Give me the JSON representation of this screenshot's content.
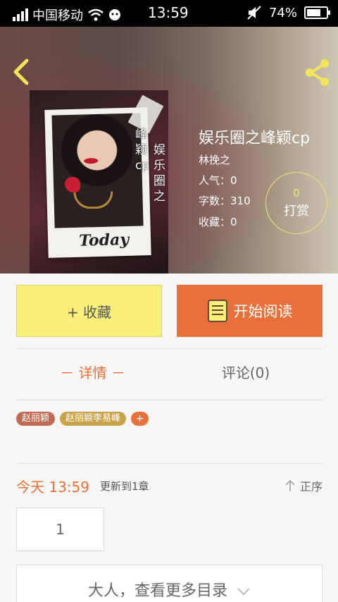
{
  "status_bar": {
    "carrier": "中国移动",
    "time": "13:59",
    "battery": "74%",
    "battery_level": 0.74
  },
  "book": {
    "title": "娱乐圈之峰颖cp",
    "author": "林挽之",
    "popularity": "人气：0",
    "word_count": "字数：310",
    "favorites": "收藏：0",
    "cover_caption": "Today",
    "cover_text_a": "峰颖cp",
    "cover_text_b": "娱乐圈之"
  },
  "tip": {
    "count": "0",
    "label": "打赏"
  },
  "actions": {
    "collect_label": "+ 收藏",
    "read_label": "开始阅读"
  },
  "tabs": {
    "detail": "－ 详情 －",
    "comments": "评论(0)"
  },
  "tags": [
    "赵丽颖",
    "赵丽颖李易峰"
  ],
  "tag_add": "+",
  "update": {
    "time": "今天 13:59",
    "note": "更新到1章",
    "sort": "正序"
  },
  "chapters": {
    "first": "1"
  },
  "more_catalog": "大人，查看更多目录",
  "colors": {
    "accent": "#e8703b",
    "collect_bg": "#f8ef7a",
    "tag1": "#c16b57",
    "tag2": "#c9a34a"
  },
  "icons": {
    "back": "chevron-left-icon",
    "share": "share-icon",
    "wifi": "wifi-icon",
    "mute": "mute-icon",
    "book": "book-icon",
    "sort": "arrow-up-icon",
    "more": "chevron-down-icon"
  }
}
